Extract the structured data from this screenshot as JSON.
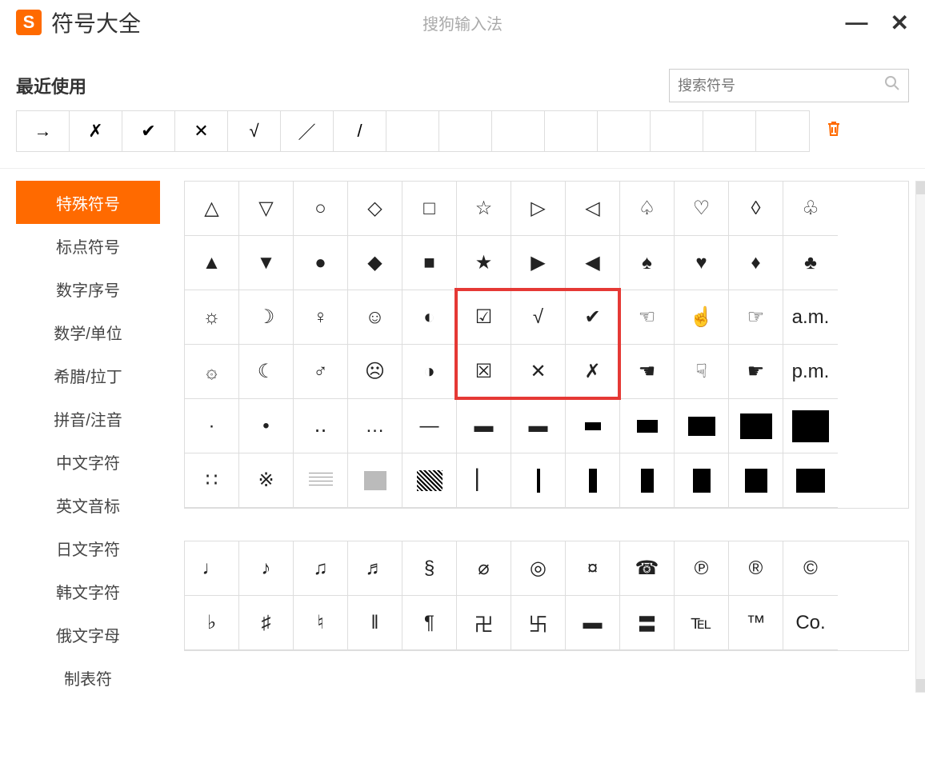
{
  "app": {
    "icon_letter": "S",
    "title": "符号大全",
    "watermark": "搜狗输入法"
  },
  "window_controls": {
    "minimize": "—",
    "close": "✕"
  },
  "recent": {
    "label": "最近使用",
    "symbols": [
      "→",
      "✗",
      "✔",
      "✕",
      "√",
      "／",
      "/",
      "",
      "",
      "",
      "",
      "",
      "",
      "",
      ""
    ]
  },
  "search": {
    "placeholder": "搜索符号"
  },
  "sidebar": {
    "items": [
      {
        "label": "特殊符号",
        "active": true
      },
      {
        "label": "标点符号"
      },
      {
        "label": "数字序号"
      },
      {
        "label": "数学/单位"
      },
      {
        "label": "希腊/拉丁"
      },
      {
        "label": "拼音/注音"
      },
      {
        "label": "中文字符"
      },
      {
        "label": "英文音标"
      },
      {
        "label": "日文字符"
      },
      {
        "label": "韩文字符"
      },
      {
        "label": "俄文字母"
      },
      {
        "label": "制表符"
      }
    ]
  },
  "grid1": [
    [
      "△",
      "▽",
      "○",
      "◇",
      "□",
      "☆",
      "▷",
      "◁",
      "♤",
      "♡",
      "◊",
      "♧"
    ],
    [
      "▲",
      "▼",
      "●",
      "◆",
      "■",
      "★",
      "▶",
      "◀",
      "♠",
      "♥",
      "♦",
      "♣"
    ],
    [
      "☼",
      "☽",
      "♀",
      "☺",
      "◐",
      "☑",
      "√",
      "✔",
      "☜",
      "☝",
      "☞",
      "a.m."
    ],
    [
      "۞",
      "☾",
      "♂",
      "☹",
      "◑",
      "☒",
      "✕",
      "✗",
      "☚",
      "☟",
      "☛",
      "p.m."
    ],
    [
      "·",
      "•",
      "‥",
      "…",
      "—",
      "▬",
      "▬",
      "RECT_SM",
      "RECT_MD",
      "RECT_LG",
      "RECT_XL",
      "RECT_XXL"
    ],
    [
      "∷",
      "※",
      "LINES",
      "GREY",
      "PATTERN",
      "▏",
      "BAR_THIN",
      "BAR_MED",
      "BAR_WIDE",
      "BAR_XWIDE",
      "BAR_XXWIDE",
      "BAR_XXXWIDE"
    ]
  ],
  "grid2": [
    [
      "♩",
      "♪",
      "♫",
      "♬",
      "§",
      "⌀",
      "◎",
      "¤",
      "☎",
      "℗",
      "®",
      "©"
    ],
    [
      "♭",
      "♯",
      "♮",
      "‖",
      "¶",
      "卍",
      "卐",
      "▬",
      "〓",
      "℡",
      "™",
      "Co."
    ]
  ],
  "highlight": {
    "row_start": 2,
    "col_start": 5,
    "rows": 2,
    "cols": 3
  }
}
